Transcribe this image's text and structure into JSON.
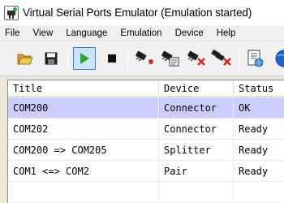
{
  "window": {
    "title": "Virtual Serial Ports Emulator (Emulation started)"
  },
  "menu": [
    {
      "label": "File"
    },
    {
      "label": "View"
    },
    {
      "label": "Language"
    },
    {
      "label": "Emulation"
    },
    {
      "label": "Device"
    },
    {
      "label": "Help"
    }
  ],
  "toolbar": {
    "buttons": [
      {
        "icon": "open-folder-icon"
      },
      {
        "icon": "save-disk-icon"
      },
      {
        "icon": "play-icon",
        "state": "pressed"
      },
      {
        "icon": "stop-icon"
      },
      {
        "icon": "new-device-icon"
      },
      {
        "icon": "edit-device-icon"
      },
      {
        "icon": "delete-device-icon"
      },
      {
        "icon": "delete-all-devices-icon"
      },
      {
        "icon": "device-properties-icon"
      },
      {
        "icon": "web-globe-icon"
      }
    ]
  },
  "table": {
    "columns": [
      {
        "label": "Title"
      },
      {
        "label": "Device"
      },
      {
        "label": "Status"
      }
    ],
    "rows": [
      {
        "title": "COM200",
        "device": "Connector",
        "status": "OK",
        "selected": true
      },
      {
        "title": "COM202",
        "device": "Connector",
        "status": "Ready",
        "selected": false
      },
      {
        "title": "COM200 => COM205",
        "device": "Splitter",
        "status": "Ready",
        "selected": false
      },
      {
        "title": "COM1 <=> COM2",
        "device": "Pair",
        "status": "Ready",
        "selected": false
      }
    ]
  },
  "colors": {
    "selected_row": "#ccccff",
    "play_green": "#2ea82e",
    "accent_red": "#e02020"
  }
}
